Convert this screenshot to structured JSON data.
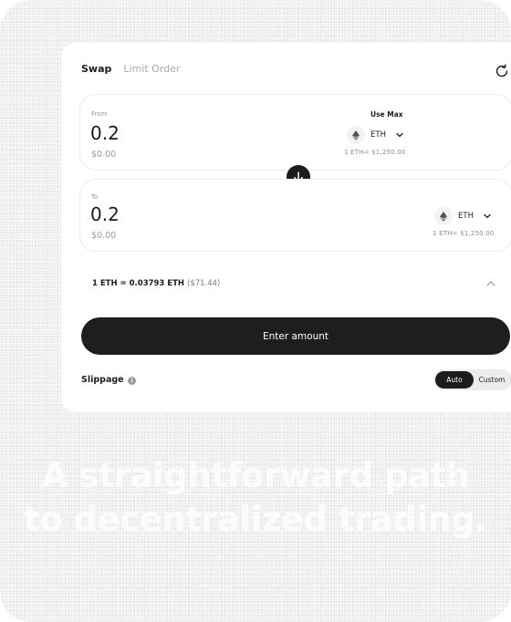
{
  "tabs": [
    {
      "label": "Swap",
      "active": true
    },
    {
      "label": "Limit Order",
      "active": false
    }
  ],
  "from": {
    "label": "From",
    "amount": "0.2",
    "usd": "$0.00",
    "use_max": "Use Max",
    "token": "ETH",
    "rate": "1 ETH= $1,250.00"
  },
  "to": {
    "label": "To",
    "amount": "0.2",
    "usd": "$0.00",
    "token": "ETH",
    "rate": "1 ETH= $1,250.00"
  },
  "rate_line": {
    "text": "1 ETH = 0.03793 ETH",
    "usd": "($71.44)"
  },
  "action_button": "Enter amount",
  "slippage": {
    "label": "Slippage",
    "options": [
      "Auto",
      "Custom"
    ],
    "selected": "Auto"
  },
  "headline": {
    "line1": "A straightforward path",
    "line2": "to decentralized trading."
  },
  "icons": {
    "refresh": "refresh-icon",
    "eth": "eth-icon",
    "chevron": "chevron-down-icon",
    "swap": "arrow-down-icon",
    "collapse": "chevron-up-icon",
    "info": "info-icon"
  },
  "colors": {
    "primary": "#1c1c1c",
    "muted": "#9a9a9a",
    "background": "#eeeeec"
  }
}
